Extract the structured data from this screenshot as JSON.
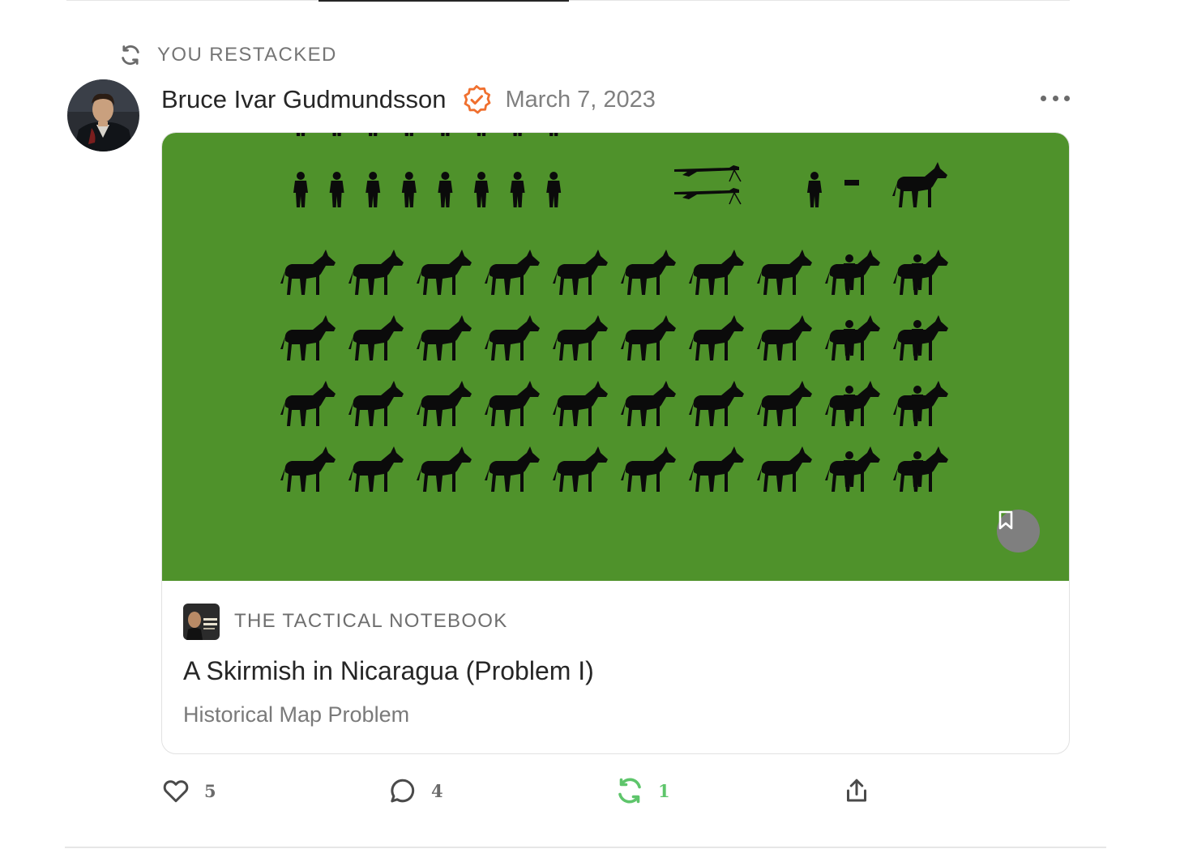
{
  "restack": {
    "label": "YOU RESTACKED",
    "icon": "restack-icon"
  },
  "post": {
    "author": "Bruce Ivar Gudmundsson",
    "date": "March 7, 2023",
    "verified_icon": "verified-badge-icon",
    "more_icon": "more-options-icon"
  },
  "card": {
    "image_background": "#4f922b",
    "publication": "THE TACTICAL NOTEBOOK",
    "title": "A Skirmish in Nicaragua (Problem I)",
    "subtitle": "Historical Map Problem",
    "bookmark_icon": "bookmark-icon"
  },
  "actions": {
    "like": {
      "icon": "heart-icon",
      "count": "5"
    },
    "comment": {
      "icon": "comment-icon",
      "count": "4"
    },
    "restack": {
      "icon": "restack-icon",
      "count": "1",
      "color": "#5ec56b"
    },
    "share": {
      "icon": "share-icon"
    }
  },
  "colors": {
    "verified": "#f0702f",
    "text_primary": "#262626",
    "text_secondary": "#757575",
    "restack_active": "#5ec56b"
  }
}
